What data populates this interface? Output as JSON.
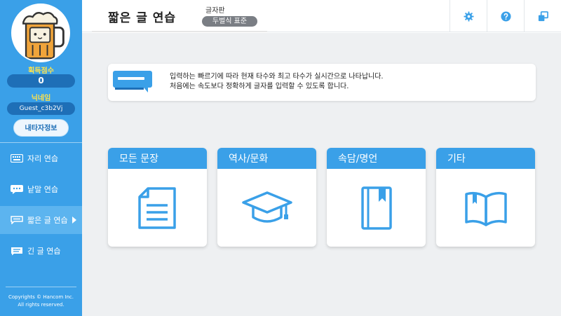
{
  "sidebar": {
    "score_label": "획득점수",
    "score_value": "0",
    "nick_label": "닉네임",
    "nick_value": "Guest_c3b2Vj",
    "profile_button": "내타자정보",
    "menu": [
      {
        "label": "자리 연습",
        "icon": "keyboard-icon"
      },
      {
        "label": "낱말 연습",
        "icon": "speech-bubble-icon"
      },
      {
        "label": "짧은 글 연습",
        "icon": "short-text-icon",
        "active": true
      },
      {
        "label": "긴 글 연습",
        "icon": "long-text-icon"
      }
    ],
    "copyright_line1": "Copyrights © Hancom Inc.",
    "copyright_line2": "All rights reserved."
  },
  "header": {
    "title": "짧은 글 연습",
    "keyboard_label": "글자판",
    "keyboard_value": "두벌식 표준",
    "buttons": [
      "gear-icon",
      "help-icon",
      "window-icon"
    ]
  },
  "notice": {
    "line1": "입력하는 빠르기에 따라 현재 타수와 최고 타수가 실시간으로 나타납니다.",
    "line2": "처음에는 속도보다 정확하게 글자를 입력할 수 있도록 합니다."
  },
  "categories": [
    {
      "label": "모든 문장",
      "icon": "document-icon"
    },
    {
      "label": "역사/문화",
      "icon": "graduation-cap-icon"
    },
    {
      "label": "속담/명언",
      "icon": "book-icon"
    },
    {
      "label": "기타",
      "icon": "open-book-icon"
    }
  ],
  "colors": {
    "accent": "#3aa0e8",
    "dark_accent": "#1e6fb7",
    "highlight": "#ffe24a"
  }
}
